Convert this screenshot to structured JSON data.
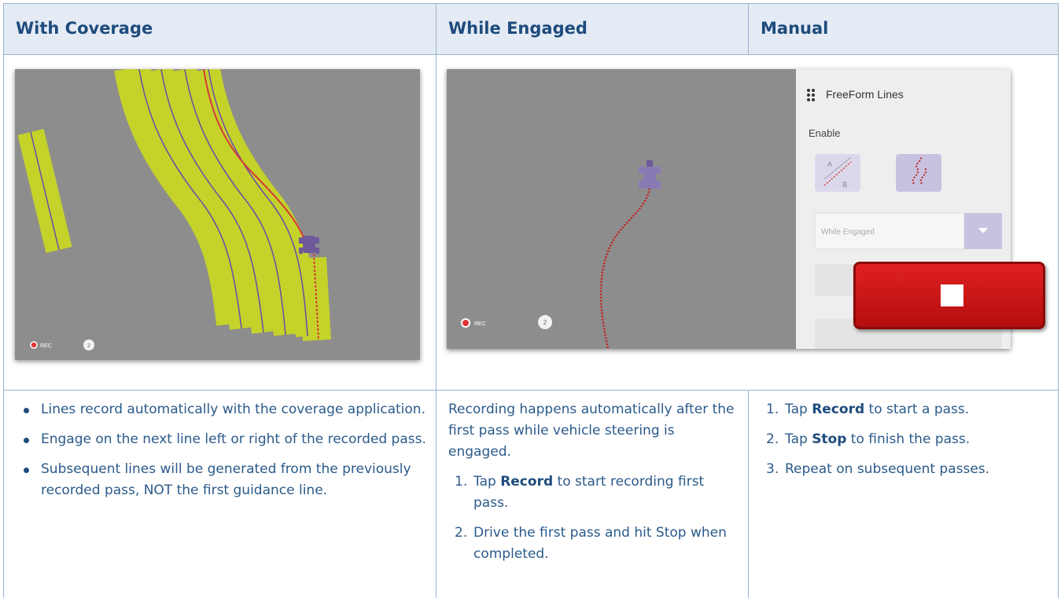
{
  "headers": {
    "col1": "With Coverage",
    "col2": "While Engaged",
    "col3": "Manual"
  },
  "shot1": {
    "rec_label": "REC",
    "counter": "2"
  },
  "shot2": {
    "panel_title": "FreeForm Lines",
    "enable_label": "Enable",
    "ab_letters": {
      "a": "A",
      "b": "B"
    },
    "dropdown_value": "While Engaged",
    "rec_label": "REC",
    "counter": "2"
  },
  "col1_items": [
    "Lines record automatically with the coverage application.",
    "Engage on the next line left or right of the recorded pass.",
    "Subsequent lines will be generated from the previously recorded pass, NOT the first guidance line."
  ],
  "col2": {
    "intro": "Recording happens automatically after the first pass while vehicle steering is engaged.",
    "steps": [
      {
        "num": "1.",
        "pre": "Tap ",
        "bold": "Record",
        "post": " to start recording first pass."
      },
      {
        "num": "2.",
        "pre": "Drive the first pass and hit Stop when completed.",
        "bold": "",
        "post": ""
      }
    ]
  },
  "col3_steps": [
    {
      "num": "1.",
      "pre": "Tap ",
      "bold": "Record",
      "post": " to start a pass."
    },
    {
      "num": "2.",
      "pre": "Tap ",
      "bold": "Stop",
      "post": " to finish the pass."
    },
    {
      "num": "3.",
      "pre": "Repeat on subsequent passes.",
      "bold": "",
      "post": ""
    }
  ],
  "colors": {
    "header_bg": "#e4ebf4",
    "header_text": "#1e4b7d",
    "body_text": "#2b5a8a",
    "coverage": "#c4d22a",
    "guide_line": "#d43a3a",
    "stop_button": "#c81414"
  }
}
